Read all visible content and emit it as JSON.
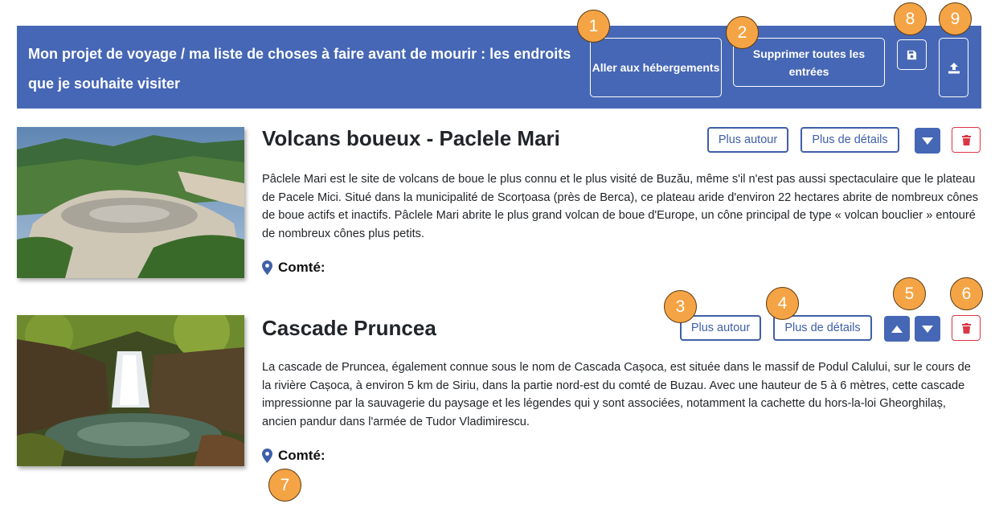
{
  "header": {
    "title": "Mon projet de voyage / ma liste de choses à faire avant de mourir : les endroits que je souhaite visiter",
    "lodging_button": "Aller aux hébergements",
    "delete_all_button": "Supprimer toutes les entrées",
    "save_icon": "save-icon",
    "upload_icon": "upload-icon"
  },
  "items": [
    {
      "title": "Volcans boueux - Paclele Mari",
      "description": "Pâclele Mari est le site de volcans de boue le plus connu et le plus visité de Buzău, même s'il n'est pas aussi spectaculaire que le plateau de Pacele Mici. Situé dans la municipalité de Scorțoasa (près de Berca), ce plateau aride d'environ 22 hectares abrite de nombreux cônes de boue actifs et inactifs. Pâclele Mari abrite le plus grand volcan de boue d'Europe, un cône principal de type « volcan bouclier » entouré de nombreux cônes plus petits.",
      "county_label": "Comté:",
      "nearby_button": "Plus autour",
      "details_button": "Plus de détails"
    },
    {
      "title": "Cascade Pruncea",
      "description": "La cascade de Pruncea, également connue sous le nom de Cascada Cașoca, est située dans le massif de Podul Calului, sur le cours de la rivière Cașoca, à environ 5 km de Siriu, dans la partie nord-est du comté de Buzau. Avec une hauteur de 5 à 6 mètres, cette cascade impressionne par la sauvagerie du paysage et les légendes qui y sont associées, notamment la cachette du hors-la-loi Gheorghilaș, ancien pandur dans l'armée de Tudor Vladimirescu.",
      "county_label": "Comté:",
      "nearby_button": "Plus autour",
      "details_button": "Plus de détails"
    }
  ],
  "markers": [
    "1",
    "2",
    "3",
    "4",
    "5",
    "6",
    "7",
    "8",
    "9"
  ],
  "colors": {
    "header_bg": "#4667b5",
    "button_blue": "#3f5fa8",
    "delete_red": "#dc3545",
    "marker_orange": "#f5a445"
  }
}
